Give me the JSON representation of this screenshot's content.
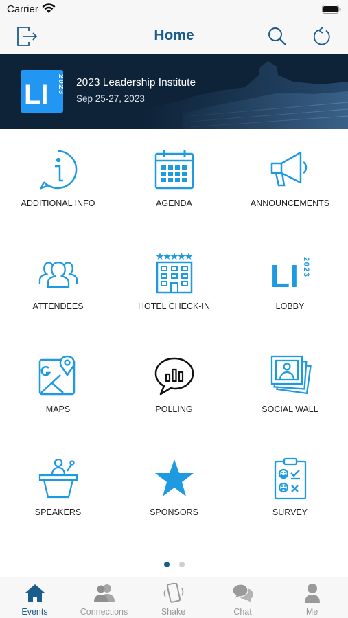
{
  "status_bar": {
    "carrier": "Carrier"
  },
  "nav": {
    "title": "Home"
  },
  "banner": {
    "logo_letters": "LI",
    "logo_year": "2023",
    "event_name": "2023 Leadership Institute",
    "event_dates": "Sep 25-27, 2023"
  },
  "tiles": [
    {
      "label": "ADDITIONAL INFO",
      "icon": "info-icon"
    },
    {
      "label": "AGENDA",
      "icon": "calendar-icon"
    },
    {
      "label": "ANNOUNCEMENTS",
      "icon": "megaphone-icon"
    },
    {
      "label": "ATTENDEES",
      "icon": "people-icon"
    },
    {
      "label": "HOTEL CHECK-IN",
      "icon": "hotel-icon"
    },
    {
      "label": "LOBBY",
      "icon": "li-logo-icon",
      "logo_letters": "LI",
      "logo_year": "2023"
    },
    {
      "label": "MAPS",
      "icon": "map-icon"
    },
    {
      "label": "POLLING",
      "icon": "poll-chat-icon"
    },
    {
      "label": "SOCIAL WALL",
      "icon": "photos-icon"
    },
    {
      "label": "SPEAKERS",
      "icon": "podium-icon"
    },
    {
      "label": "SPONSORS",
      "icon": "star-icon"
    },
    {
      "label": "SURVEY",
      "icon": "survey-icon"
    }
  ],
  "pagination": {
    "pages": 2,
    "current": 1
  },
  "tab_bar": [
    {
      "label": "Events",
      "icon": "home-icon",
      "active": true
    },
    {
      "label": "Connections",
      "icon": "connections-icon",
      "active": false
    },
    {
      "label": "Shake",
      "icon": "shake-phone-icon",
      "active": false
    },
    {
      "label": "Chat",
      "icon": "chat-icon",
      "active": false
    },
    {
      "label": "Me",
      "icon": "person-icon",
      "active": false
    }
  ],
  "colors": {
    "accent": "#1a5d8c",
    "icon_blue": "#1e9ae0",
    "banner_bg": "#0e2338",
    "tab_inactive": "#9a9a9a"
  }
}
